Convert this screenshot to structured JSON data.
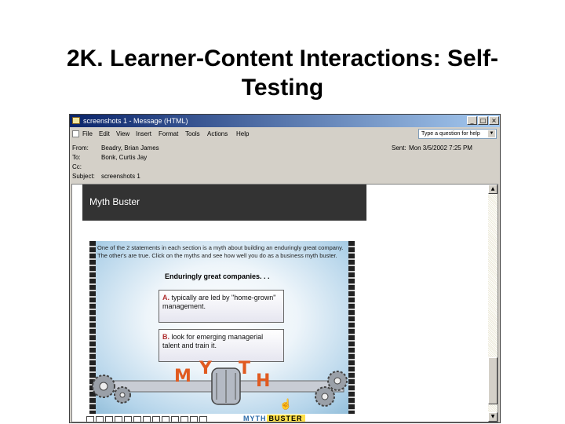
{
  "slide": {
    "title_line1": "2K. Learner-Content Interactions: Self-",
    "title_line2": "Testing"
  },
  "window": {
    "title": "screenshots 1 - Message (HTML)",
    "minimize": "_",
    "maximize": "□",
    "close": "×"
  },
  "menu": {
    "items": [
      "File",
      "Edit",
      "View",
      "Insert",
      "Format",
      "Tools",
      "Actions",
      "Help"
    ],
    "help_box": "Type a question for help"
  },
  "header": {
    "from_label": "From:",
    "from_value": "Beadry, Brian James",
    "to_label": "To:",
    "to_value": "Bonk, Curtis Jay",
    "cc_label": "Cc:",
    "subject_label": "Subject:",
    "subject_value": "screenshots 1",
    "sent_label": "Sent:",
    "sent_value": "Mon 3/5/2002 7:25 PM"
  },
  "scroll": {
    "up": "▲",
    "down": "▼"
  },
  "content": {
    "header_title": "Myth Buster",
    "intro": "One of the 2 statements in each section is a myth about building an enduringly great company. The other's are true. Click on the myths and see how well you do as a business myth buster.",
    "question": "Enduringly great companies. . .",
    "option_a_letter": "A.",
    "option_a": "typically are led by \"home-grown\" management.",
    "option_b_letter": "B.",
    "option_b": "look for emerging managerial talent and train it.",
    "myth_letters": [
      "M",
      "Y",
      "T",
      "H"
    ],
    "logo_part1": "MYTH",
    "logo_part2": "BUSTER"
  },
  "colors": {
    "title_bar": "#0a246a",
    "header_bg": "#333333",
    "myth_orange": "#e05a20"
  }
}
